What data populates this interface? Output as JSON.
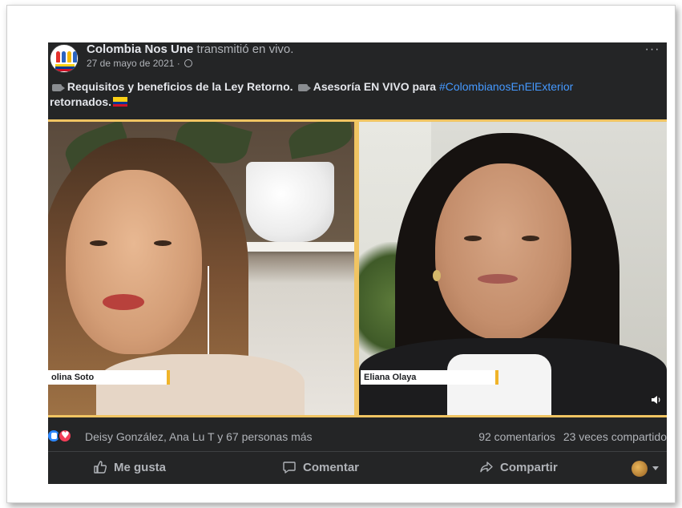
{
  "post": {
    "page_name": "Colombia Nos Une",
    "action": "transmitió en vivo.",
    "date": "27 de mayo de 2021 ·",
    "more_label": "···",
    "text_part1": "Requisitos y beneficios de la Ley Retorno.",
    "text_part2": "Asesoría EN VIVO para",
    "hashtag": "#ColombianosEnElExterior",
    "text_part3": "retornados."
  },
  "video": {
    "left_name": "olina Soto",
    "right_name": "Eliana Olaya"
  },
  "engagement": {
    "reactors": "Deisy González, Ana Lu T y 67 personas más",
    "comments": "92 comentarios",
    "shares": "23 veces compartido"
  },
  "actions": {
    "like": "Me gusta",
    "comment": "Comentar",
    "share": "Compartir"
  },
  "colors": {
    "post_bg": "#242526",
    "hashtag": "#4599ff",
    "video_border": "#f0c462",
    "like_blue": "#2d88ff",
    "love_red": "#f33e58"
  }
}
